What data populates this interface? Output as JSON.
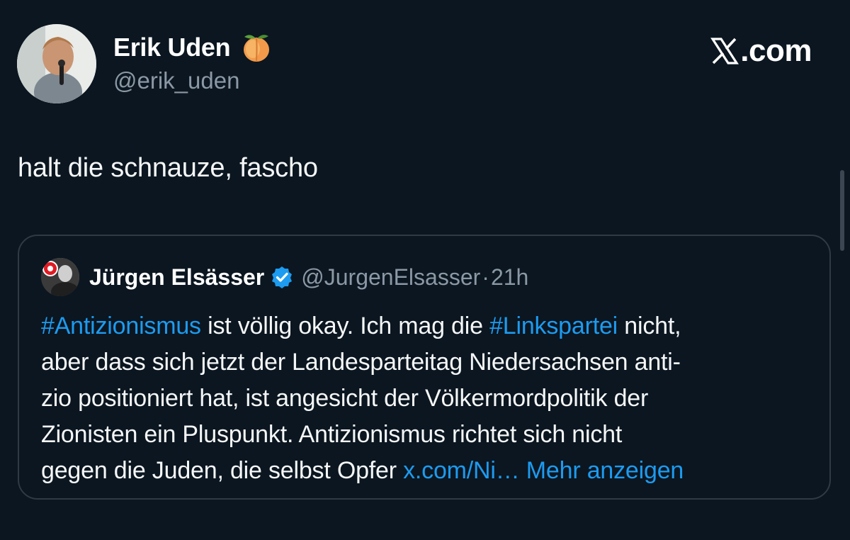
{
  "tweet": {
    "author": {
      "name": "Erik Uden",
      "emoji": "🍑",
      "handle": "@erik_uden"
    },
    "brand": "X.com",
    "brand_text": ".com",
    "text": "halt die schnauze, fascho",
    "quoted": {
      "name": "Jürgen Elsässer",
      "handle": "@JurgenElsasser",
      "separator": "·",
      "time": "21h",
      "lines": [
        {
          "parts": [
            {
              "text": "#Antizionismus",
              "link": true
            },
            {
              "text": " ist völlig okay. Ich mag die ",
              "link": false
            },
            {
              "text": "#Linkspartei",
              "link": true
            },
            {
              "text": " nicht,",
              "link": false
            }
          ]
        },
        {
          "parts": [
            {
              "text": "aber dass sich jetzt der Landesparteitag Niedersachsen anti-",
              "link": false
            }
          ]
        },
        {
          "parts": [
            {
              "text": "zio positioniert hat, ist angesicht der Völkermordpolitik der",
              "link": false
            }
          ]
        },
        {
          "parts": [
            {
              "text": "Zionisten ein Pluspunkt. Antizionismus richtet sich nicht",
              "link": false
            }
          ]
        },
        {
          "parts": [
            {
              "text": "gegen die Juden, die selbst Opfer ",
              "link": false
            },
            {
              "text": "x.com/Ni…",
              "link": true
            },
            {
              "text": " ",
              "link": false
            },
            {
              "text": "Mehr anzeigen",
              "link": true
            }
          ]
        }
      ]
    }
  },
  "colors": {
    "background": "#0b1620",
    "link": "#1d9bf0",
    "muted": "#8b98a5",
    "text": "#f5f7f8",
    "border": "#2f3a45",
    "verified": "#1d9bf0"
  },
  "icons": {
    "peach": "peach-emoji-icon",
    "x_logo": "x-logo-icon",
    "verified": "verified-badge-icon"
  }
}
